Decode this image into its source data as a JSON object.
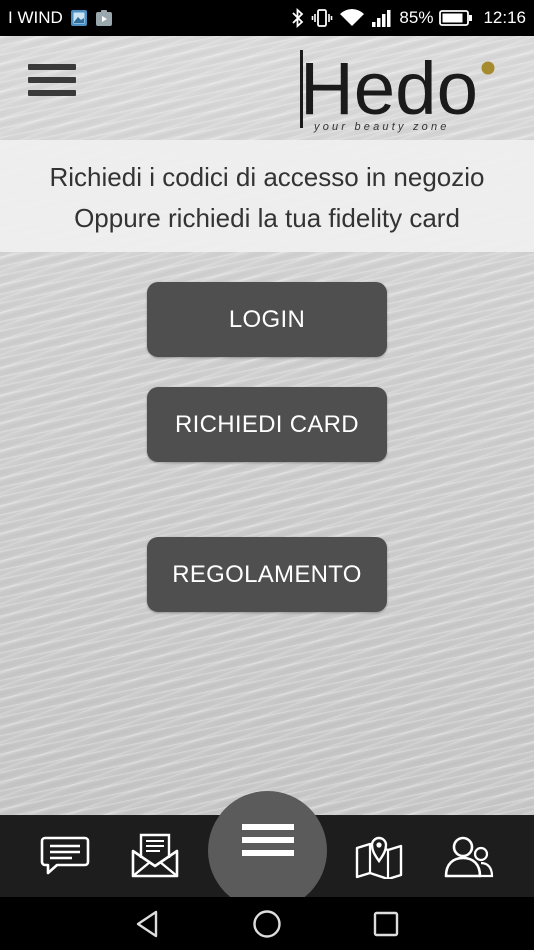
{
  "status_bar": {
    "carrier": "I WIND",
    "battery_percent": "85%",
    "time": "12:16"
  },
  "header": {
    "logo_text": "Hedo",
    "logo_tagline": "your beauty zone"
  },
  "info": {
    "line1": "Richiedi i codici di accesso in negozio",
    "line2": "Oppure richiedi la tua fidelity card"
  },
  "buttons": {
    "login": "LOGIN",
    "richiedi_card": "RICHIEDI CARD",
    "regolamento": "REGOLAMENTO"
  },
  "tab_bar": {
    "items": [
      "chat-icon",
      "mail-icon",
      "menu-icon",
      "map-icon",
      "users-icon"
    ]
  },
  "nav_bar": {
    "items": [
      "back-icon",
      "home-icon",
      "recent-apps-icon"
    ]
  },
  "colors": {
    "button_bg": "#4f4f4f",
    "tab_bar_bg": "#1d1d1d",
    "center_menu_bg": "#5b5b5b",
    "logo_dot": "#a58a2e"
  }
}
